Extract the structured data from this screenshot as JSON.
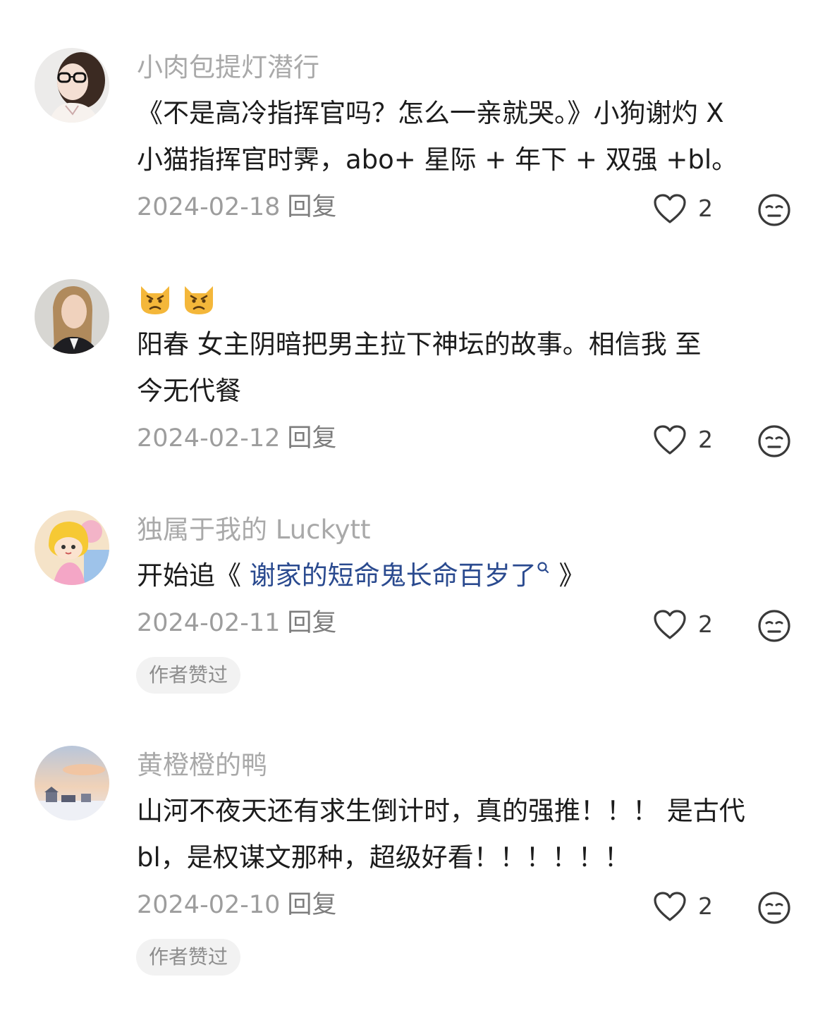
{
  "comments": [
    {
      "username": "小肉包提灯潜行",
      "text_lines": [
        "《不是高冷指挥官吗？怎么一亲就哭。》小狗谢灼 X",
        "小猫指挥官时霁，abo+ 星际 + 年下 + 双强 +bl。"
      ],
      "date": "2024-02-18",
      "reply_label": "回复",
      "likes": "2",
      "like_icon": "heart-outline-icon",
      "dislike_icon": "meh-face-icon"
    },
    {
      "emoji": [
        "😾",
        "😾"
      ],
      "text_lines": [
        "阳春 女主阴暗把男主拉下神坛的故事。相信我 至",
        "今无代餐"
      ],
      "date": "2024-02-12",
      "reply_label": "回复",
      "likes": "2"
    },
    {
      "username": "独属于我的 Luckytt",
      "text_prefix": "开始追《",
      "link_text": " 谢家的短命鬼长命百岁了",
      "link_icon": "search-icon",
      "text_suffix": " 》",
      "date": "2024-02-11",
      "reply_label": "回复",
      "likes": "2",
      "badge": "作者赞过"
    },
    {
      "username": "黄橙橙的鸭",
      "text_lines": [
        "山河不夜天还有求生倒计时，真的强推！！！ 是古代",
        "bl，是权谋文那种，超级好看！！！！！！"
      ],
      "date": "2024-02-10",
      "reply_label": "回复",
      "likes": "2",
      "badge": "作者赞过"
    }
  ],
  "colors": {
    "username": "#a9a9a9",
    "body": "#1c1c1c",
    "link": "#2a4a8f",
    "meta": "#9d9d9d",
    "badge_bg": "#f2f2f2"
  }
}
